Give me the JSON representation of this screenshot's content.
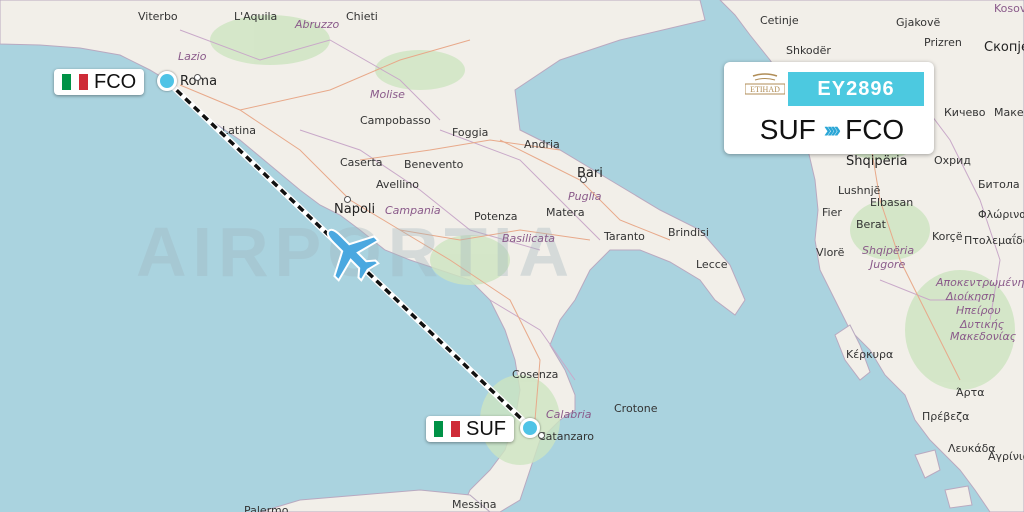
{
  "flight": {
    "number": "EY2896",
    "origin": "SUF",
    "destination": "FCO",
    "airline_logo_text": "ETIHAD",
    "chevrons": "››››"
  },
  "airports": {
    "origin_code": "SUF",
    "destination_code": "FCO",
    "origin_flag": "Italy",
    "destination_flag": "Italy"
  },
  "watermark": "AIRPORTIA",
  "places": [
    "Viterbo",
    "L'Aquila",
    "Abruzzo",
    "Chieti",
    "Lazio",
    "Roma",
    "Molise",
    "Latina",
    "Campobasso",
    "Foggia",
    "Andria",
    "Caserta",
    "Benevento",
    "Bari",
    "Avellino",
    "Puglia",
    "Napoli",
    "Campania",
    "Potenza",
    "Matera",
    "Taranto",
    "Brindisi",
    "Basilicata",
    "Lecce",
    "Cosenza",
    "Calabria",
    "Crotone",
    "Catanzaro",
    "Messina",
    "Palermo",
    "Cetinje",
    "Shkodër",
    "Gjakovë",
    "Prizren",
    "Скопје",
    "Кичево",
    "Маке",
    "Shqipëria",
    "Lushnjë",
    "Elbasan",
    "Охрид",
    "Битола",
    "Fier",
    "Berat",
    "Φλώρινα",
    "Korçë",
    "Πτολεμαΐδα",
    "Vlorë",
    "Shqipëria",
    "Jugore",
    "Αποκεντρωμένη",
    "Διοίκηση",
    "Ηπείρου",
    "Δυτικής",
    "Μακεδονίας",
    "Κέρκυρα",
    "Άρτα",
    "Πρέβεζα",
    "Λευκάδα",
    "Αγρίνιο",
    "Kosovo"
  ],
  "colors": {
    "sea": "#aad3df",
    "land": "#f2efe9",
    "route": "#111111",
    "accent": "#4cc9e0",
    "plane": "#4aa8e0"
  }
}
